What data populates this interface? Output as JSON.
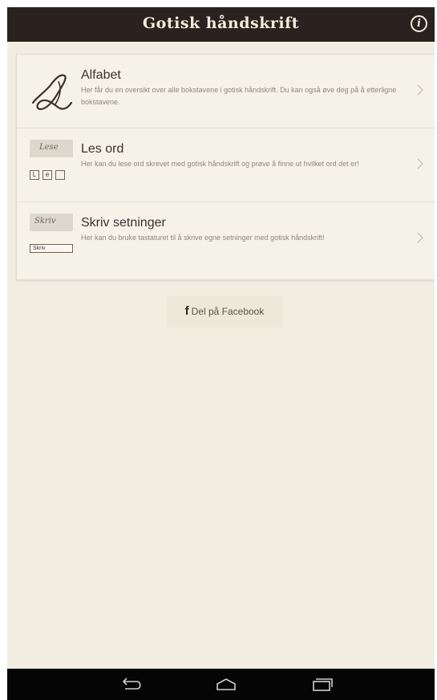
{
  "app": {
    "title": "Gotisk håndskrift",
    "info_icon": "info-icon"
  },
  "menu": {
    "items": [
      {
        "title": "Alfabet",
        "description": "Her får du en oversikt over alle bokstavene i gotisk håndskrift. Du kan også øve deg på å etterligne bokstavene.",
        "icon": "script-letter-icon"
      },
      {
        "title": "Les ord",
        "description": "Her kan du lese ord skrevet med gotisk håndskrift og prøve å finne ut hvilket ord det er!",
        "icon": "handwritten-word-icon",
        "thumb_word": "Lese",
        "thumb_letters": [
          "L",
          "e",
          ""
        ]
      },
      {
        "title": "Skriv setninger",
        "description": "Her kan du bruke tastaturet til å skrive egne setninger med gotisk håndskrift!",
        "icon": "handwritten-sentence-icon",
        "thumb_word": "Skriv",
        "thumb_field": "Skriv"
      }
    ]
  },
  "share": {
    "label": "Del på Facebook",
    "icon": "facebook-icon",
    "icon_glyph": "f"
  },
  "system_nav": {
    "buttons": [
      "back-icon",
      "home-icon",
      "recent-apps-icon"
    ]
  },
  "colors": {
    "titlebar": "#2b211e",
    "background": "#f1ede1",
    "card": "#f5f2e8",
    "navbar": "#050505"
  }
}
